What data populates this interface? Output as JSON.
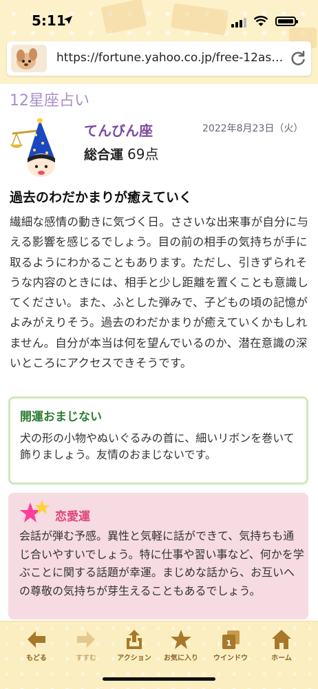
{
  "status_bar": {
    "time": "5:11"
  },
  "address_bar": {
    "url": "https://fortune.yahoo.co.jp/free-12astr..."
  },
  "page": {
    "app_title": "12星座占い",
    "sign_name": "てんびん座",
    "date": "2022年8月23日（火）",
    "overall_label": "総合運",
    "overall_score": "69点",
    "headline": "過去のわだかまりが癒えていく",
    "body": "繊細な感情の動きに気づく日。ささいな出来事が自分に与える影響を感じるでしょう。目の前の相手の気持ちが手に取るようにわかることもあります。ただし、引きずられそうな内容のときには、相手と少し距離を置くことも意識してください。また、ふとした弾みで、子どもの頃の記憶がよみがえりそう。過去のわだかまりが癒えていくかもしれません。自分が本当は何を望んでいるのか、潜在意識の深いところにアクセスできそうです。"
  },
  "lucky_charm": {
    "title": "開運おまじない",
    "text": "犬の形の小物やぬいぐるみの首に、細いリボンを巻いて飾りましょう。友情のおまじないです。"
  },
  "love": {
    "title": "恋愛運",
    "text": "会話が弾む予感。異性と気軽に話ができて、気持ちも通じ合いやすいでしょう。特に仕事や習い事など、何かを学ぶことに関する話題が幸運。まじめな話から、お互いへの尊敬の気持ちが芽生えることもあるでしょう。"
  },
  "toolbar": {
    "back": "もどる",
    "forward": "すすむ",
    "action": "アクション",
    "favorite": "お気に入り",
    "window": "ウインドウ",
    "home": "ホーム",
    "window_count": "1"
  },
  "colors": {
    "accent_purple": "#7b4aa0",
    "title_lavender": "#a88fc8",
    "lucky_green": "#2e7d32",
    "love_pink": "#e0457b",
    "love_bg": "#f6dbe3",
    "toolbar_bg": "#fbeec0"
  },
  "icons": {
    "back": "arrow-left-icon",
    "forward": "arrow-right-icon",
    "action": "share-icon",
    "favorite": "star-icon",
    "window": "windows-icon",
    "home": "home-icon"
  }
}
